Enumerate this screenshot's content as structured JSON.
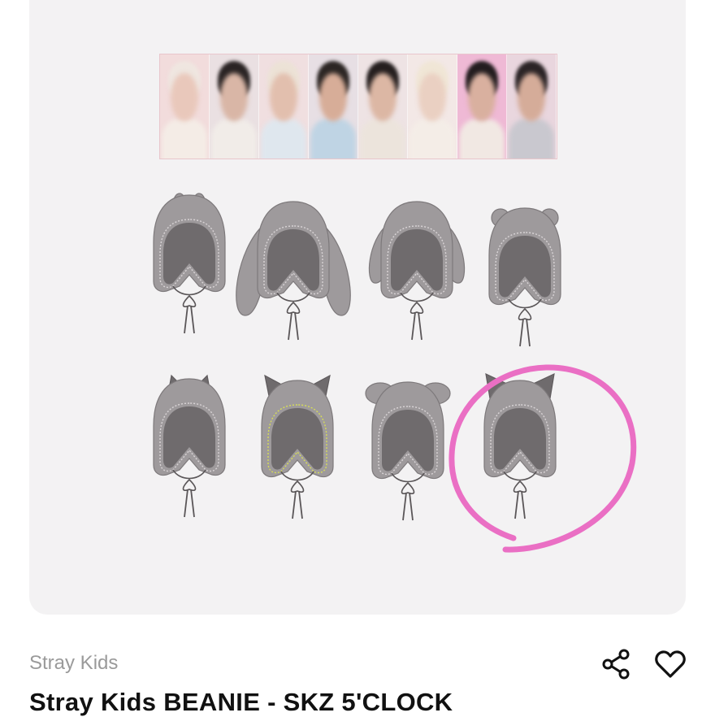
{
  "product": {
    "seller": "Stray Kids",
    "title": "Stray Kids BEANIE - SKZ 5'CLOCK"
  },
  "image": {
    "photocards": [
      {
        "bg": "#f2dcdc",
        "hair": "#efe6e0",
        "face": "#e9c8bb",
        "body": "#f4ece6"
      },
      {
        "bg": "#eae0e2",
        "hair": "#2a2424",
        "face": "#d9b6a6",
        "body": "#f1ece8"
      },
      {
        "bg": "#f0dfe0",
        "hair": "#ece2d6",
        "face": "#e2bfae",
        "body": "#dfe7ee"
      },
      {
        "bg": "#e7dfe4",
        "hair": "#2c2624",
        "face": "#d7ad98",
        "body": "#bfd4e4"
      },
      {
        "bg": "#eee3e4",
        "hair": "#251f1f",
        "face": "#dcb7a4",
        "body": "#ece4dc"
      },
      {
        "bg": "#f3e8e6",
        "hair": "#f0e6d6",
        "face": "#ead0c2",
        "body": "#f4ede7"
      },
      {
        "bg": "#efb9d5",
        "hair": "#231d1f",
        "face": "#d9b09f",
        "body": "#f1e8e3"
      },
      {
        "bg": "#e9d6de",
        "hair": "#2b2426",
        "face": "#d5ac99",
        "body": "#c9c8cf"
      }
    ],
    "beanie_color": "#9e9a9c",
    "highlight_circle_color": "#ea6fc4"
  },
  "actions": {
    "share_icon": "share-icon",
    "like_icon": "heart-icon"
  }
}
